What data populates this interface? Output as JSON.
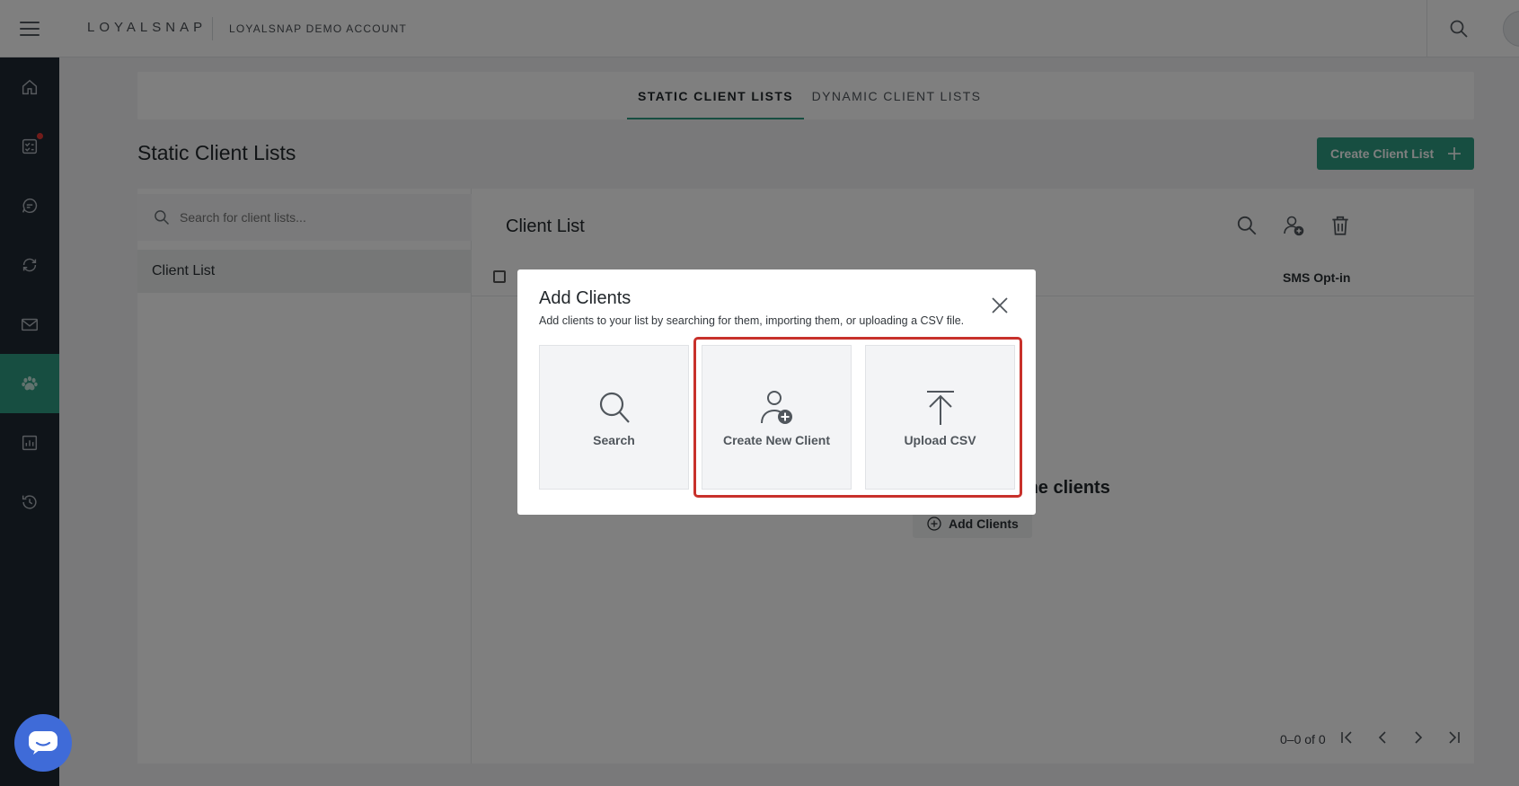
{
  "header": {
    "logo": "LOYALSNAP",
    "account_name": "LOYALSNAP DEMO ACCOUNT"
  },
  "sidebar": {
    "items": [
      {
        "icon": "home-icon"
      },
      {
        "icon": "tasks-icon",
        "has_notification": true
      },
      {
        "icon": "chat-icon"
      },
      {
        "icon": "sync-icon"
      },
      {
        "icon": "mail-icon"
      },
      {
        "icon": "paw-icon",
        "active": true
      },
      {
        "icon": "chart-icon"
      },
      {
        "icon": "history-icon"
      }
    ]
  },
  "tabs": {
    "static": "STATIC CLIENT LISTS",
    "dynamic": "DYNAMIC CLIENT LISTS"
  },
  "page": {
    "title": "Static Client Lists",
    "create_button": "Create Client List"
  },
  "list_pane": {
    "search_placeholder": "Search for client lists...",
    "items": [
      "Client List"
    ]
  },
  "detail": {
    "title": "Client List",
    "columns": {
      "sms": "SMS Opt-in"
    },
    "empty_text": "me clients",
    "add_button": "Add Clients",
    "pagination": "0–0 of 0"
  },
  "modal": {
    "title": "Add Clients",
    "subtitle": "Add clients to your list by searching for them, importing them, or uploading a CSV file.",
    "options": [
      {
        "label": "Search",
        "icon": "search-icon"
      },
      {
        "label": "Create New Client",
        "icon": "add-user-icon"
      },
      {
        "label": "Upload CSV",
        "icon": "upload-icon"
      }
    ]
  },
  "colors": {
    "accent": "#2e9c82",
    "sidebar": "#1f2933",
    "highlight": "#c8312b",
    "chat": "#3f6bd8"
  }
}
